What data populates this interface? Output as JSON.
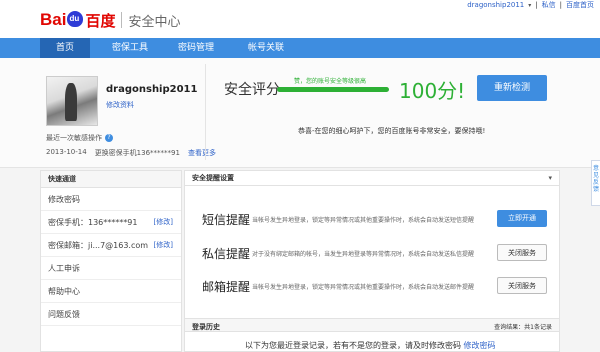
{
  "header": {
    "logo_bai": "Bai",
    "logo_du": "百度",
    "site_title": "安全中心",
    "username": "dragonship2011",
    "privacy_link": "私信",
    "home_link": "百度首页"
  },
  "nav": {
    "items": [
      "首页",
      "密保工具",
      "密码管理",
      "帐号关联"
    ],
    "active_index": 0
  },
  "profile": {
    "username": "dragonship2011",
    "edit_link": "修改资料",
    "recent_label": "最近一次敏感操作",
    "recent_date": "2013-10-14",
    "recent_action": "更换密保手机136******91",
    "recent_more": "查看更多"
  },
  "security": {
    "label": "安全评分",
    "tip": "赞，您的账号安全等级很高",
    "score": "100分!",
    "score_value": 100,
    "recheck_button": "重新检测",
    "note": "恭喜-在您的细心呵护下，您的百度账号非常安全，要保持哦!"
  },
  "quick_links": {
    "title": "快速通道",
    "items": [
      {
        "label": "修改密码",
        "action": ""
      },
      {
        "label": "密保手机：136******91",
        "action": "[修改]"
      },
      {
        "label": "密保邮箱：ji...7@163.com",
        "action": "[修改]"
      },
      {
        "label": "人工申诉",
        "action": ""
      },
      {
        "label": "帮助中心",
        "action": ""
      },
      {
        "label": "问题反馈",
        "action": ""
      }
    ]
  },
  "reminders": {
    "title": "安全提醒设置",
    "items": [
      {
        "name": "短信提醒",
        "desc": "当帐号发生异地登录，锁定等异常情况或其他重要操作时，系统会自动发送短信提醒",
        "button": "立即开通",
        "primary": true
      },
      {
        "name": "私信提醒",
        "desc": "对于没有绑定邮箱的帐号，当发生异地登录等异常情况时，系统会自动发送私信提醒",
        "button": "关闭服务",
        "primary": false
      },
      {
        "name": "邮箱提醒",
        "desc": "当帐号发生异地登录，锁定等异常情况或其他重要操作时，系统会自动发送邮件提醒",
        "button": "关闭服务",
        "primary": false
      }
    ]
  },
  "history": {
    "title": "登录历史",
    "result": "查询结果：共1条记录",
    "text": "以下为您最近登录记录，若有不是您的登录，请及时修改密码",
    "link": "修改密码"
  },
  "side_tab": {
    "label": "意见反馈"
  }
}
